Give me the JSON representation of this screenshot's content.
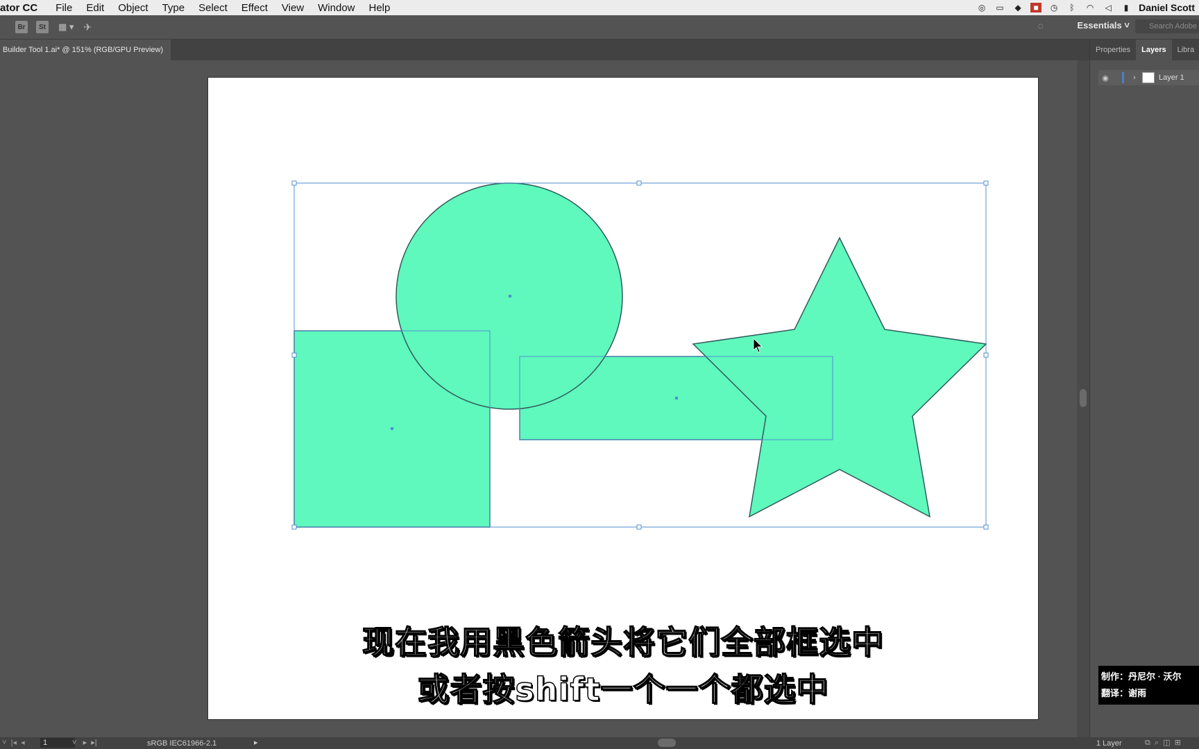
{
  "menubar": {
    "app_name": "ator CC",
    "items": [
      "File",
      "Edit",
      "Object",
      "Type",
      "Select",
      "Effect",
      "View",
      "Window",
      "Help"
    ],
    "user": "Daniel Scott"
  },
  "toolbar": {
    "bridge_label": "Br",
    "stock_label": "St",
    "workspace": "Essentials",
    "search_placeholder": "Search Adobe"
  },
  "document": {
    "tab_title": "Builder Tool 1.ai* @ 151% (RGB/GPU Preview)"
  },
  "artwork": {
    "fill_color": "#5ff8bd",
    "stroke_color": "#2f5a5a",
    "selection_color": "#4f8fd0"
  },
  "subtitles": {
    "line1": "现在我用黑色箭头将它们全部框选中",
    "line2": "或者按shift一个一个都选中"
  },
  "panel": {
    "tabs": [
      "Properties",
      "Layers",
      "Libra"
    ],
    "active_tab": "Layers",
    "layer_name": "Layer 1",
    "credit_line1": "制作：丹尼尔 · 沃尔",
    "credit_line2": "翻译：谢雨"
  },
  "statusbar": {
    "page_number": "1",
    "color_profile": "sRGB IEC61966-2.1",
    "layer_count": "1 Layer"
  }
}
